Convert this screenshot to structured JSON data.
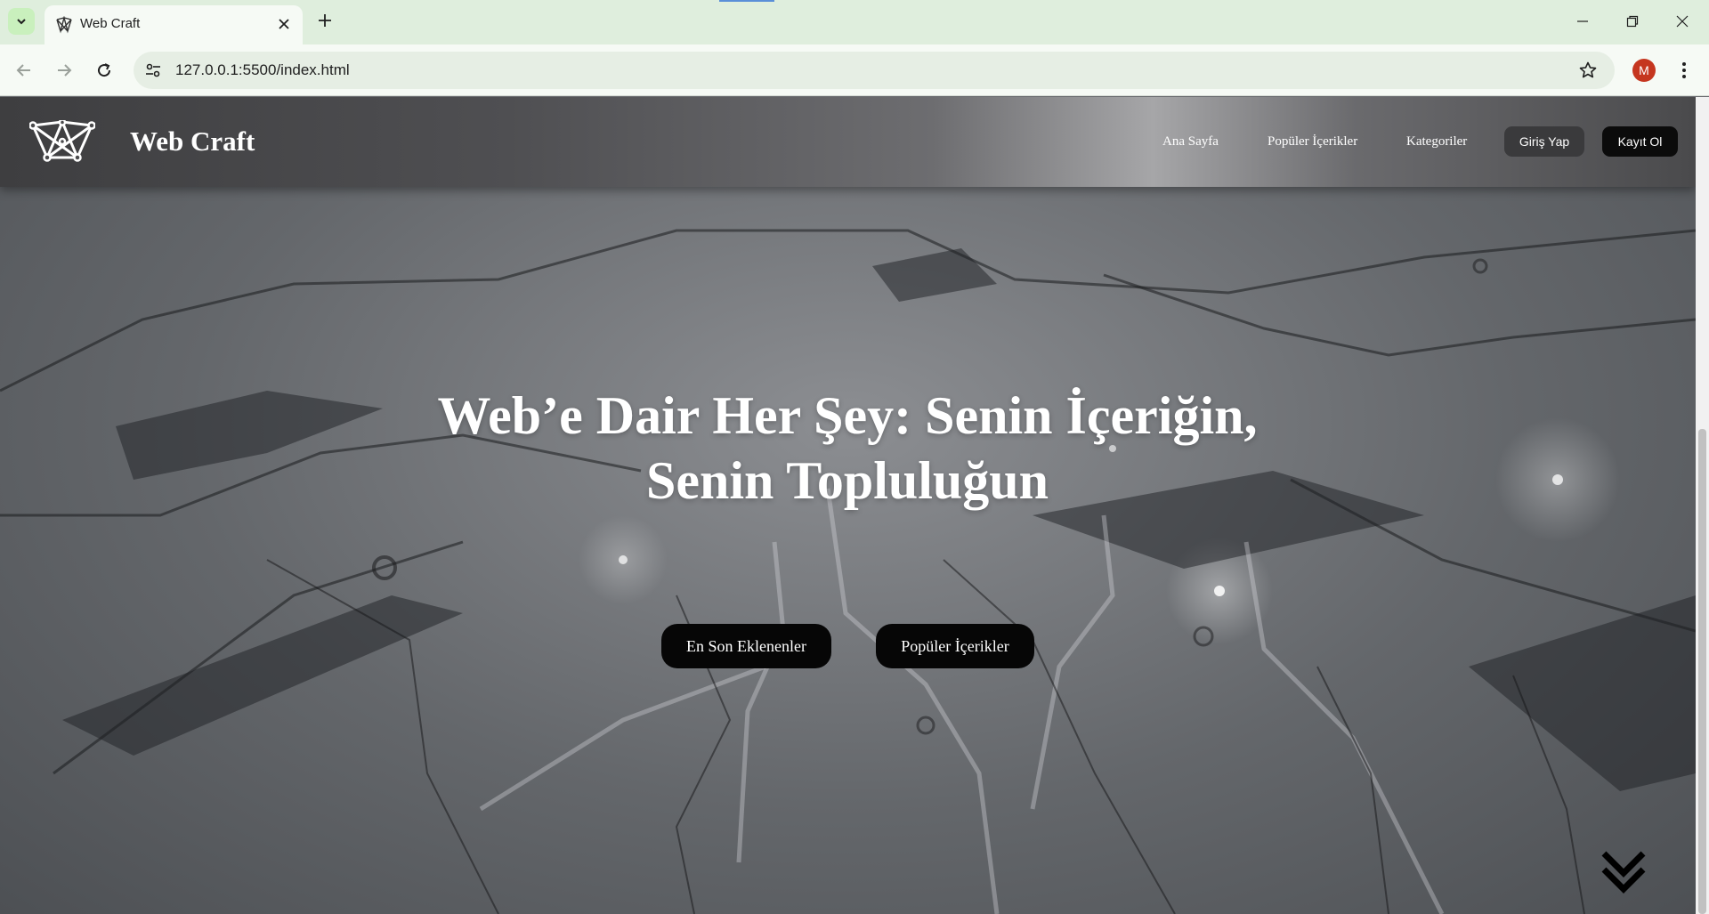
{
  "browser": {
    "tab_title": "Web Craft",
    "url": "127.0.0.1:5500/index.html",
    "profile_initial": "M"
  },
  "site": {
    "brand": "Web Craft",
    "nav": [
      "Ana Sayfa",
      "Popüler İçerikler",
      "Kategoriler"
    ],
    "login_label": "Giriş Yap",
    "register_label": "Kayıt Ol"
  },
  "hero": {
    "title_line1": "Web’e Dair Her Şey: Senin İçeriğin,",
    "title_line2": "Senin Topluluğun",
    "primary_button": "En Son Eklenenler",
    "secondary_button": "Popüler İçerikler"
  },
  "colors": {
    "tabstrip": "#dfeedd",
    "toolbar": "#f6faf5",
    "avatar": "#c5361f",
    "button_dark": "#060606"
  }
}
